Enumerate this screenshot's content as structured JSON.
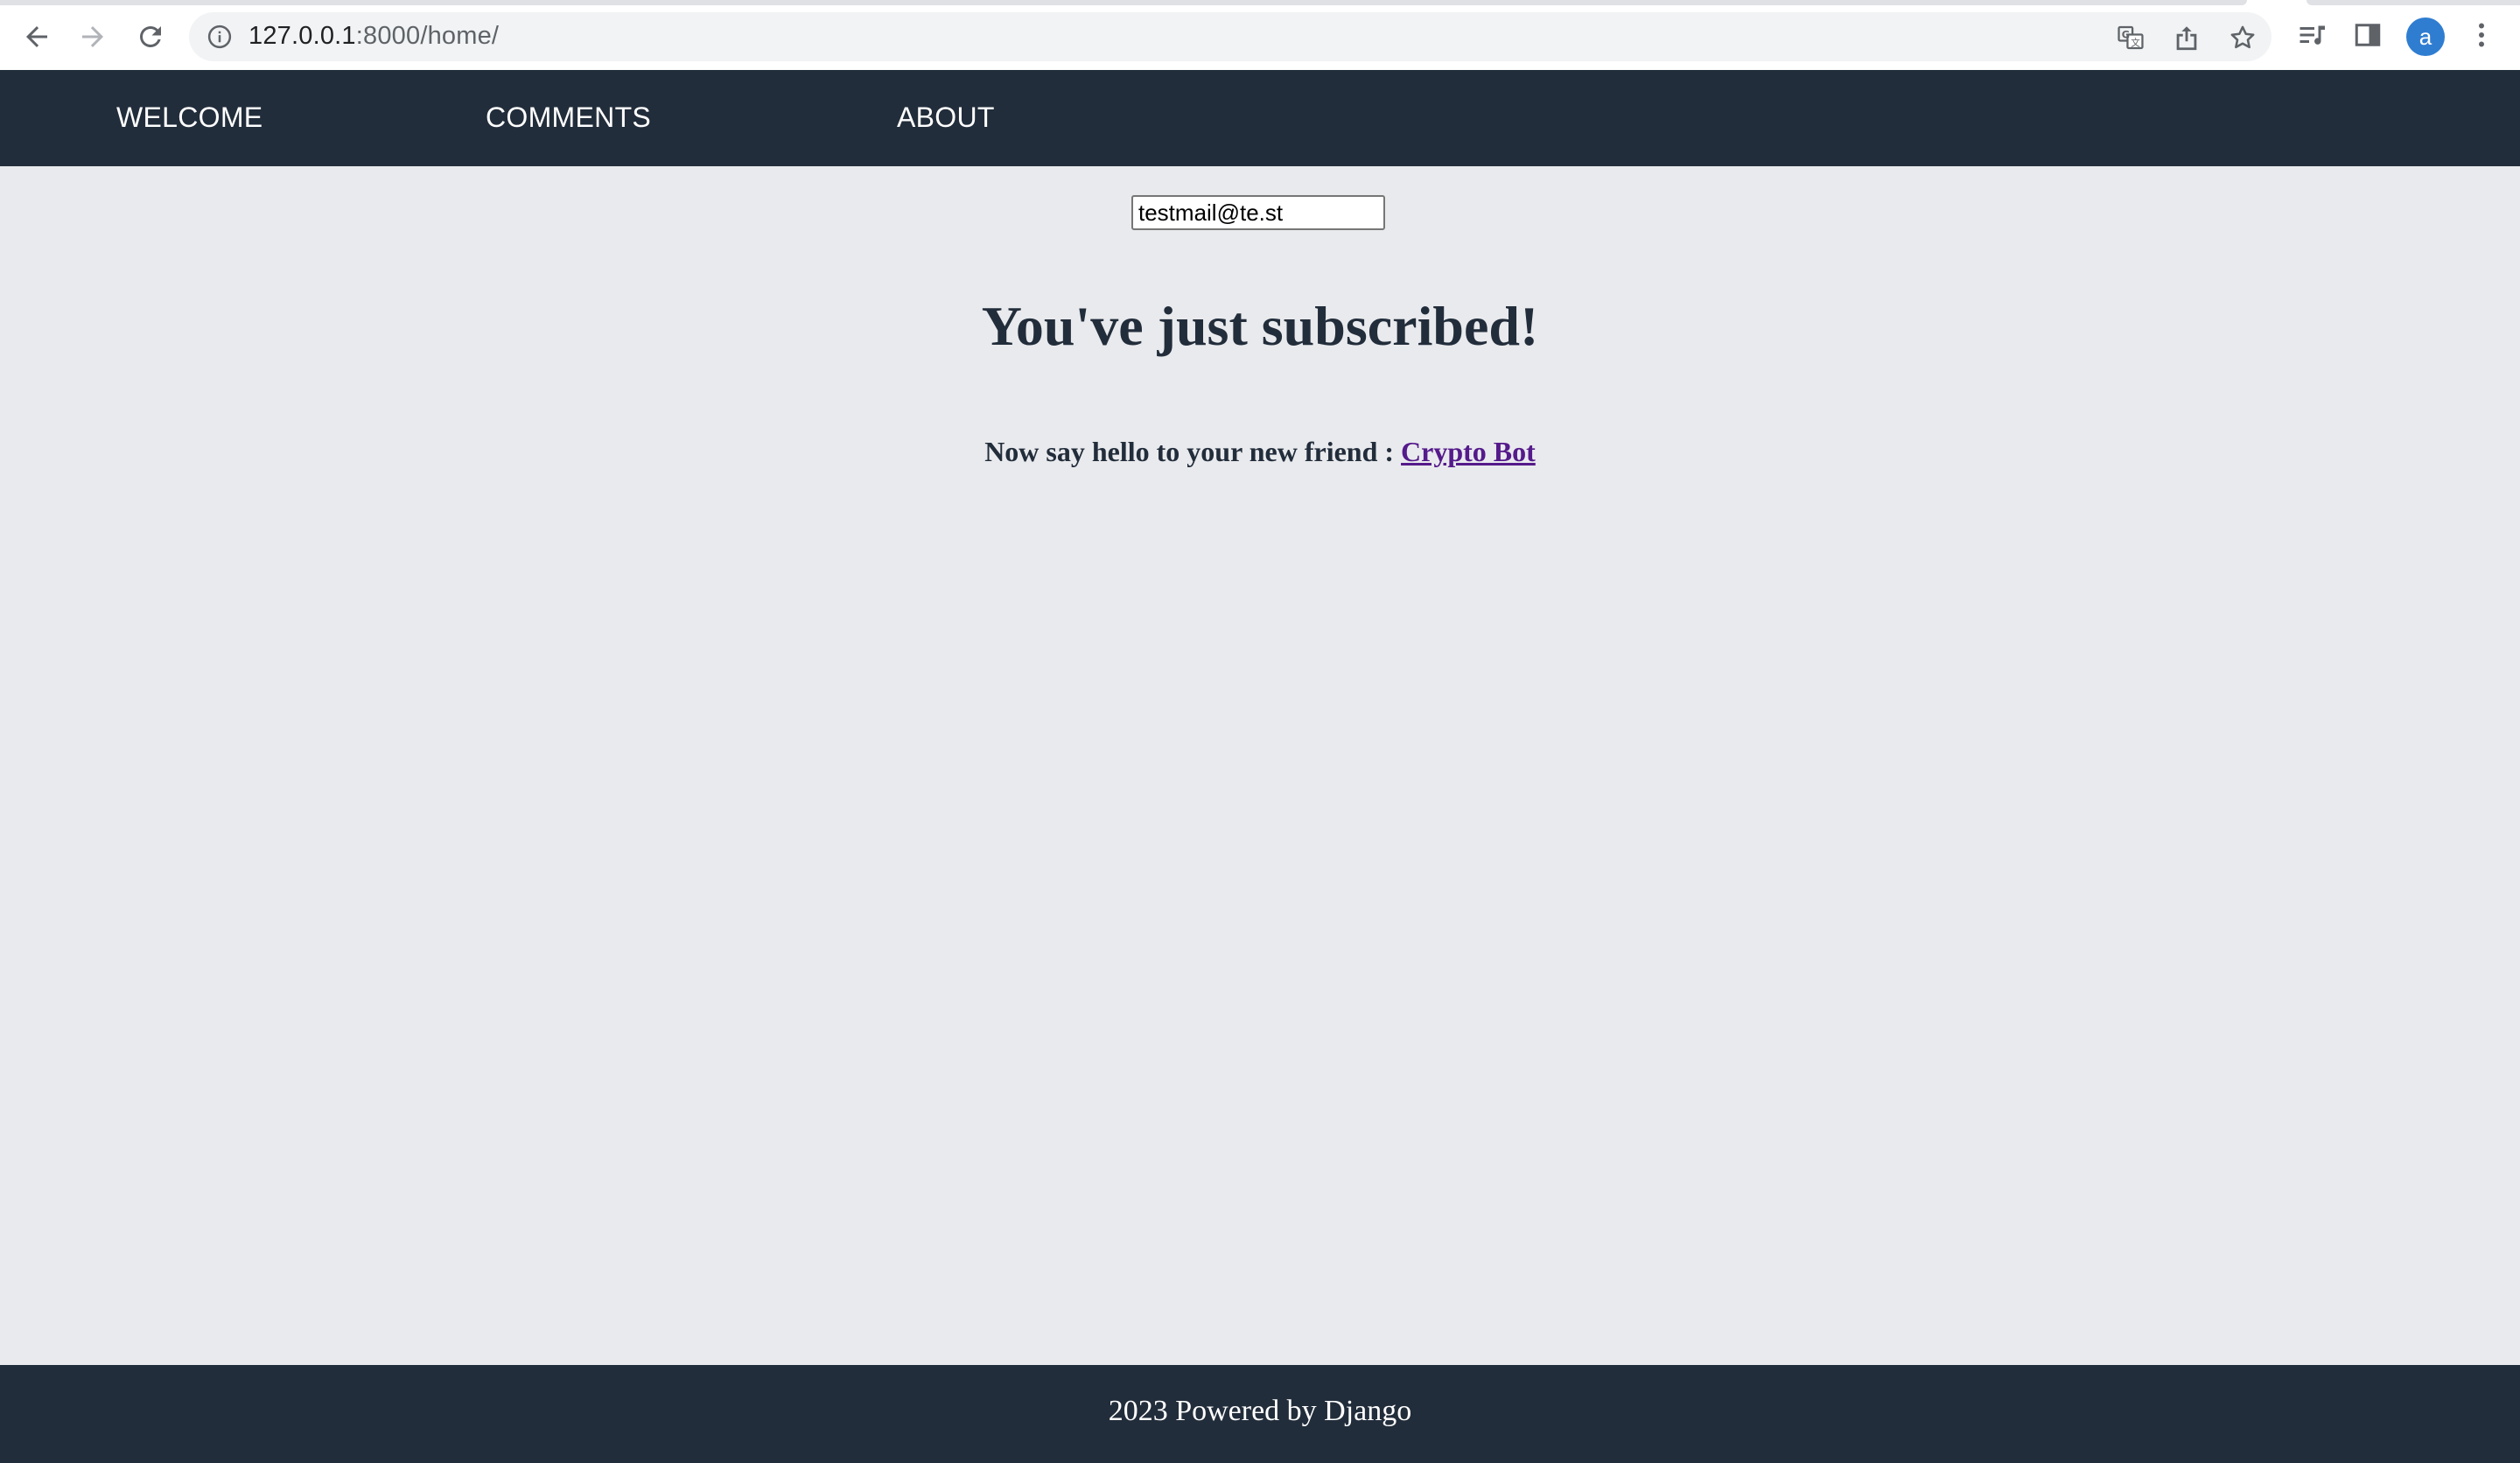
{
  "browser": {
    "url_host": "127.0.0.1",
    "url_rest": ":8000/home/",
    "profile_initial": "a",
    "icons": {
      "back": "back-arrow-icon",
      "forward": "forward-arrow-icon",
      "reload": "reload-icon",
      "site_info": "info-icon",
      "translate": "translate-icon",
      "share": "share-icon",
      "bookmark": "star-icon",
      "reading_list": "reading-list-icon",
      "side_panel": "side-panel-icon",
      "menu": "kebab-menu-icon"
    }
  },
  "nav": {
    "items": [
      {
        "label": "WELCOME"
      },
      {
        "label": "COMMENTS"
      },
      {
        "label": "ABOUT"
      }
    ]
  },
  "main": {
    "email_value": "testmail@te.st",
    "headline": "You've just subscribed!",
    "subline_text": "Now say hello to your new friend : ",
    "bot_link": "Crypto Bot"
  },
  "footer": {
    "text": "2023 Powered by Django"
  },
  "colors": {
    "nav_bg": "#222d3b",
    "page_bg": "#e9eaed",
    "heading": "#222d3b",
    "visited_link": "#551a8b",
    "avatar": "#2f7dd1"
  }
}
